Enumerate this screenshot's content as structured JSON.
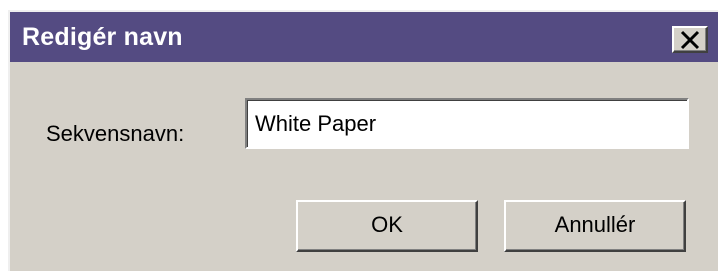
{
  "window": {
    "title": "Redigér navn",
    "close_icon": "close-icon",
    "colors": {
      "titlebar": "#544b82",
      "title_text": "#ffffff",
      "face": "#d4d0c8"
    }
  },
  "form": {
    "label": "Sekvensnavn:",
    "value": "White Paper"
  },
  "buttons": {
    "ok_label": "OK",
    "cancel_label": "Annullér"
  }
}
